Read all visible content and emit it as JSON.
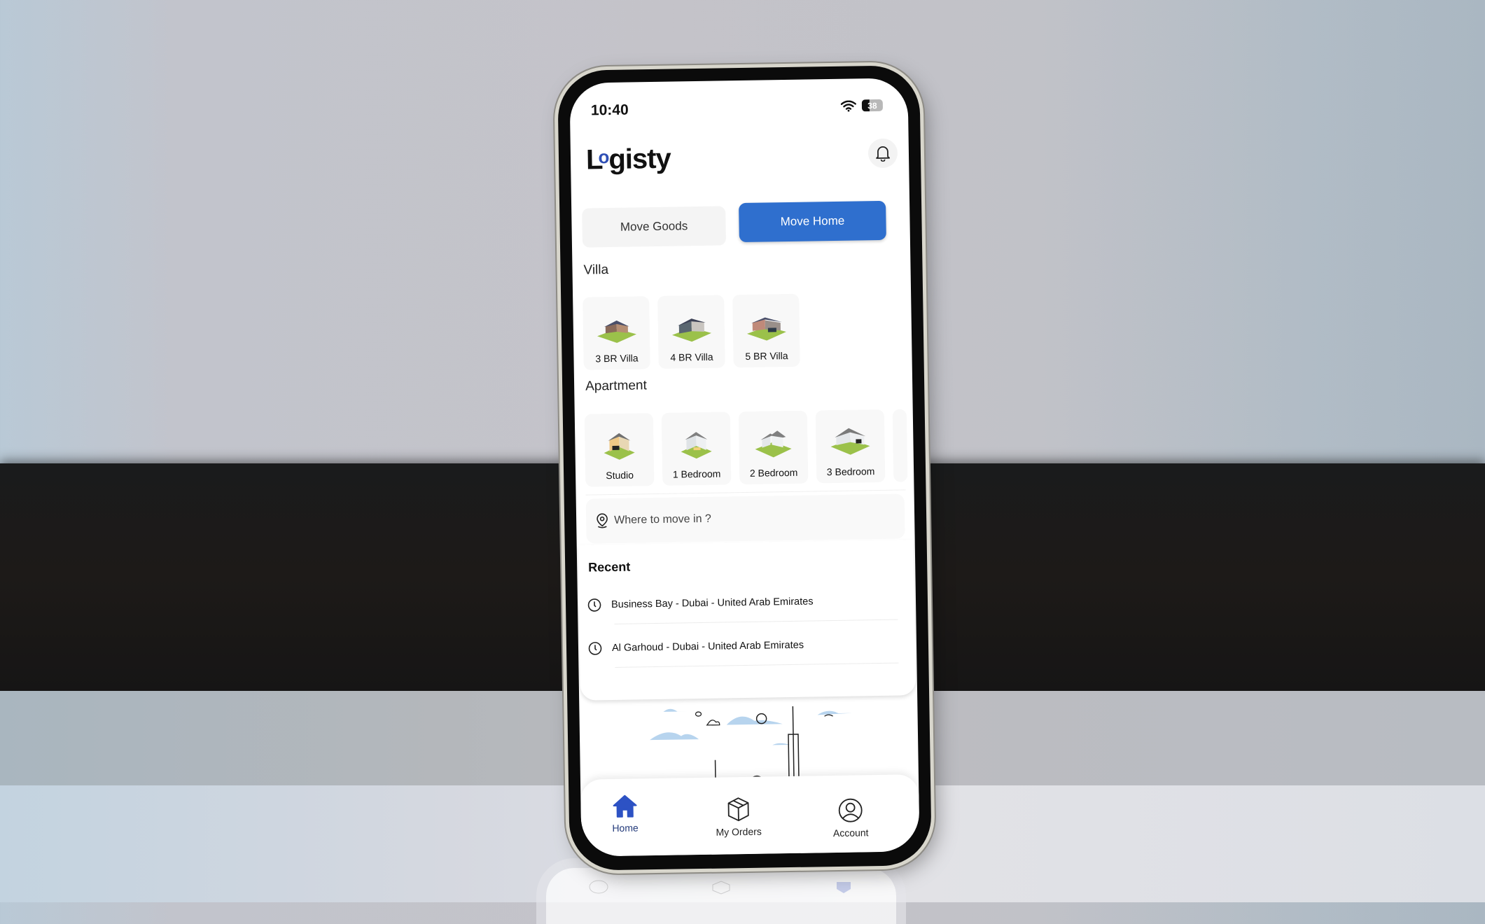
{
  "status_bar": {
    "time": "10:40",
    "battery": "38"
  },
  "app": {
    "logo_prefix": "L",
    "logo_o": "o",
    "logo_rest": "gisty",
    "brand_color": "#2f4fb5",
    "accent_color": "#2f6fce"
  },
  "segmented": {
    "move_goods": "Move Goods",
    "move_home": "Move Home",
    "active": "Move Home"
  },
  "villa": {
    "title": "Villa",
    "items": [
      {
        "label": "3 BR Villa"
      },
      {
        "label": "4 BR Villa"
      },
      {
        "label": "5 BR Villa"
      }
    ]
  },
  "apartment": {
    "title": "Apartment",
    "items": [
      {
        "label": "Studio"
      },
      {
        "label": "1 Bedroom"
      },
      {
        "label": "2 Bedroom"
      },
      {
        "label": "3 Bedroom"
      }
    ]
  },
  "search": {
    "placeholder": "Where to move in ?"
  },
  "recent": {
    "title": "Recent",
    "items": [
      {
        "label": "Business Bay - Dubai - United Arab Emirates"
      },
      {
        "label": "Al Garhoud - Dubai - United Arab Emirates"
      }
    ]
  },
  "bottom_nav": {
    "items": [
      {
        "label": "Home",
        "icon": "home-icon",
        "active": true
      },
      {
        "label": "My Orders",
        "icon": "box-icon",
        "active": false
      },
      {
        "label": "Account",
        "icon": "user-icon",
        "active": false
      }
    ]
  }
}
